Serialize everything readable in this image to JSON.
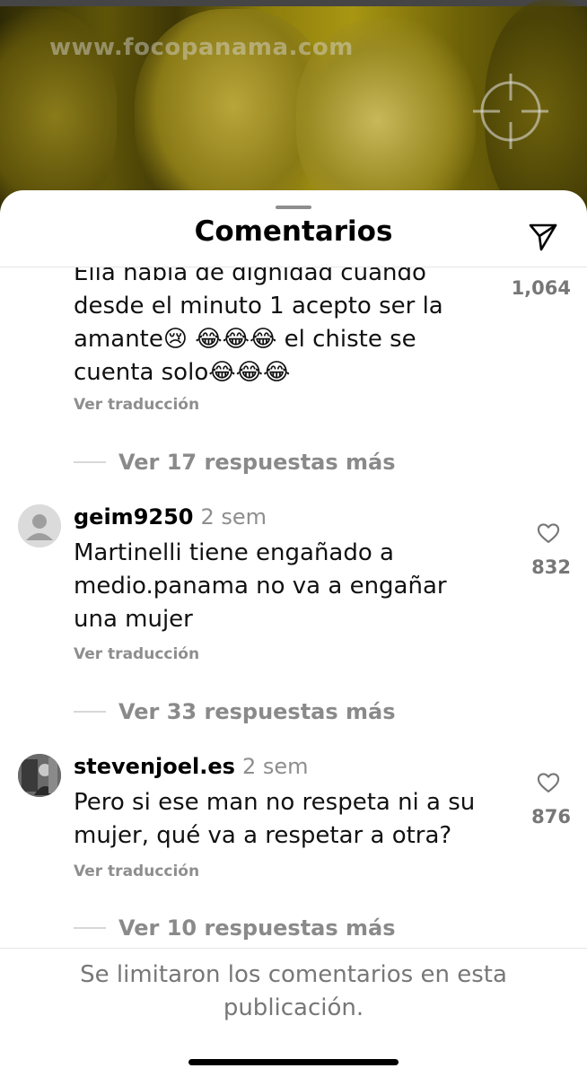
{
  "post": {
    "watermark": "www.focopanama.com"
  },
  "sheet": {
    "title": "Comentarios",
    "share_icon": "send-icon"
  },
  "comments": [
    {
      "text_lines": [
        "Ella habla de dignidad cuando",
        "desde el minuto 1 acepto ser la",
        "amante😢 😂😂😂 el chiste se",
        "cuenta solo😂😂😂"
      ],
      "likes": "1,064",
      "see_translation": "Ver traducción",
      "more_replies": "Ver 17 respuestas más"
    },
    {
      "username": "geim9250",
      "time": "2 sem",
      "text_lines": [
        "Martinelli tiene engañado a",
        "medio.panama no va a engañar",
        "una mujer"
      ],
      "likes": "832",
      "see_translation": "Ver traducción",
      "more_replies": "Ver 33 respuestas más"
    },
    {
      "username": "stevenjoel.es",
      "time": "2 sem",
      "text_lines": [
        "Pero si ese man no respeta ni a su",
        "mujer, qué va a respetar a otra?"
      ],
      "likes": "876",
      "see_translation": "Ver traducción",
      "more_replies": "Ver 10 respuestas más"
    }
  ],
  "footer": {
    "line1": "Se limitaron los comentarios en esta",
    "line2": "publicación."
  }
}
